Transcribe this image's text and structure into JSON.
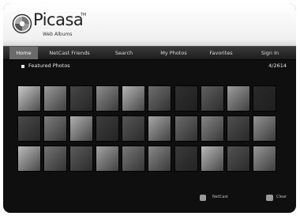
{
  "logo": {
    "name": "Picasa",
    "tm": "TM",
    "subtitle": "Web Albums"
  },
  "nav": {
    "items": [
      {
        "label": "Home",
        "selected": true
      },
      {
        "label": "NetCast Friends"
      },
      {
        "label": "Search"
      },
      {
        "label": "My Photos"
      },
      {
        "label": "Favorites"
      },
      {
        "label": "Sign In"
      }
    ]
  },
  "section": {
    "title": "Featured Photos",
    "page_counter": "4/2614"
  },
  "photos": {
    "rows": 3,
    "columns": 10,
    "tones": [
      "#c9c9c9",
      "#9a9a9a",
      "#464646",
      "#8d8d8d",
      "#b4b4b4",
      "#6e6e6e",
      "#2f2f2f",
      "#5f5f5f",
      "#9e9e9e",
      "#2a2a2a",
      "#4a4a4a",
      "#7d7d7d",
      "#b0b0b0",
      "#3d3d3d",
      "#565656",
      "#a7a7a7",
      "#6b6b6b",
      "#858585",
      "#4f4f4f",
      "#929292",
      "#bdbdbd",
      "#737373",
      "#5a5a5a",
      "#a3a3a3",
      "#787878",
      "#888888",
      "#3a3a3a",
      "#b8b8b8",
      "#525252",
      "#969696"
    ]
  },
  "footer": {
    "netcast_label": "NetCast",
    "clear_label": "Clear"
  },
  "colors": {
    "background": "#0f0f0f",
    "navbar": "#2a2a2a",
    "selected_tab": "#6a6a6a",
    "text": "#e8e8e8"
  }
}
